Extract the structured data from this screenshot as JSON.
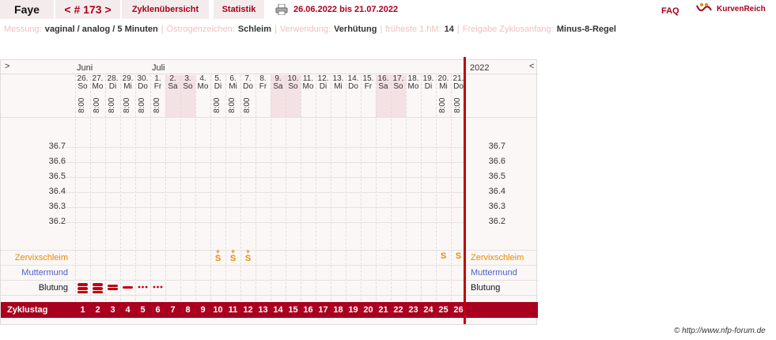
{
  "topbar": {
    "user_name": "Faye",
    "cycle_number": "< # 173 >",
    "tab_cycle_overview": "Zyklenübersicht",
    "tab_statistics": "Statistik",
    "date_range": "26.06.2022 bis 21.07.2022",
    "faq": "FAQ",
    "logo_text": "KurvenReich"
  },
  "info": {
    "measurement_label": "Messung:",
    "measurement_value": "vaginal / analog / 5 Minuten",
    "estrogen_label": "Östrogenzeichen:",
    "estrogen_value": "Schleim",
    "usage_label": "Verwendung:",
    "usage_value": "Verhütung",
    "earliest_label": "früheste 1.hM:",
    "earliest_value": "14",
    "release_label": "Freigabe Zyklusanfang:",
    "release_value": "Minus-8-Regel"
  },
  "chart": {
    "nav_left": ">",
    "nav_right": "<",
    "months": [
      "Juni",
      "Juli"
    ],
    "year": "2022",
    "days": [
      {
        "date": "26.",
        "wd": "So",
        "time": "8:00",
        "we": false
      },
      {
        "date": "27.",
        "wd": "Mo",
        "time": "8:00",
        "we": false
      },
      {
        "date": "28.",
        "wd": "Di",
        "time": "8:00",
        "we": false
      },
      {
        "date": "29.",
        "wd": "Mi",
        "time": "8:00",
        "we": false
      },
      {
        "date": "30.",
        "wd": "Do",
        "time": "8:00",
        "we": false
      },
      {
        "date": "1.",
        "wd": "Fr",
        "time": "8:00",
        "we": false
      },
      {
        "date": "2.",
        "wd": "Sa",
        "time": "",
        "we": true
      },
      {
        "date": "3.",
        "wd": "So",
        "time": "",
        "we": true
      },
      {
        "date": "4.",
        "wd": "Mo",
        "time": "",
        "we": false
      },
      {
        "date": "5.",
        "wd": "Di",
        "time": "8:00",
        "we": false
      },
      {
        "date": "6.",
        "wd": "Mi",
        "time": "8:00",
        "we": false
      },
      {
        "date": "7.",
        "wd": "Do",
        "time": "8:00",
        "we": false
      },
      {
        "date": "8.",
        "wd": "Fr",
        "time": "",
        "we": false
      },
      {
        "date": "9.",
        "wd": "Sa",
        "time": "",
        "we": true
      },
      {
        "date": "10.",
        "wd": "So",
        "time": "",
        "we": true
      },
      {
        "date": "11.",
        "wd": "Mo",
        "time": "",
        "we": false
      },
      {
        "date": "12.",
        "wd": "Di",
        "time": "",
        "we": false
      },
      {
        "date": "13.",
        "wd": "Mi",
        "time": "",
        "we": false
      },
      {
        "date": "14.",
        "wd": "Do",
        "time": "",
        "we": false
      },
      {
        "date": "15.",
        "wd": "Fr",
        "time": "",
        "we": false
      },
      {
        "date": "16.",
        "wd": "Sa",
        "time": "",
        "we": true
      },
      {
        "date": "17.",
        "wd": "So",
        "time": "",
        "we": true
      },
      {
        "date": "18.",
        "wd": "Mo",
        "time": "",
        "we": false
      },
      {
        "date": "19.",
        "wd": "Di",
        "time": "",
        "we": false
      },
      {
        "date": "20.",
        "wd": "Mi",
        "time": "8:00",
        "we": false
      },
      {
        "date": "21.",
        "wd": "Do",
        "time": "8:00",
        "we": false
      }
    ],
    "temp_labels": [
      "36.7",
      "36.6",
      "36.5",
      "36.4",
      "36.3",
      "36.2"
    ],
    "row_cervical": "Zervixschleim",
    "row_cervix": "Muttermund",
    "row_bleeding": "Blutung",
    "row_cycleday": "Zyklustag",
    "cervical_marks": [
      {
        "day": 10,
        "sym": "S",
        "plus": true
      },
      {
        "day": 11,
        "sym": "S",
        "plus": true
      },
      {
        "day": 12,
        "sym": "S",
        "plus": true
      },
      {
        "day": 25,
        "sym": "S",
        "plus": false
      },
      {
        "day": 26,
        "sym": "S",
        "plus": false
      }
    ],
    "bleeding": [
      {
        "day": 1,
        "level": "heavy"
      },
      {
        "day": 2,
        "level": "heavy"
      },
      {
        "day": 3,
        "level": "medium"
      },
      {
        "day": 4,
        "level": "light"
      },
      {
        "day": 5,
        "level": "spotting"
      },
      {
        "day": 6,
        "level": "spotting"
      }
    ],
    "cycle_days": [
      "1",
      "2",
      "3",
      "4",
      "5",
      "6",
      "7",
      "8",
      "9",
      "10",
      "11",
      "12",
      "13",
      "14",
      "15",
      "16",
      "17",
      "18",
      "19",
      "20",
      "21",
      "22",
      "23",
      "24",
      "25",
      "26"
    ]
  },
  "footer": "© http://www.nfp-forum.de",
  "colors": {
    "accent": "#a8001e",
    "orange": "#e88a00",
    "blue": "#4a63c8"
  }
}
